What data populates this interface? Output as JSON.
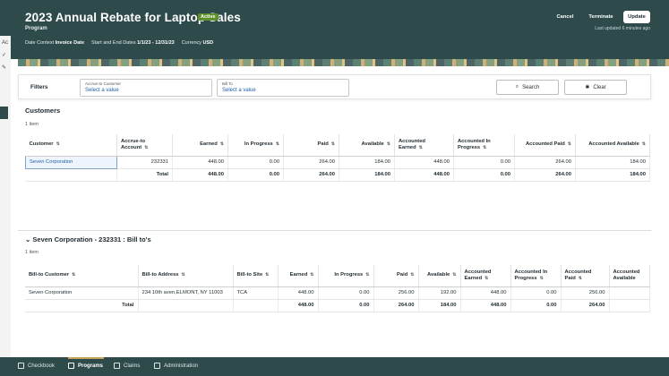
{
  "header": {
    "title": "2023 Annual Rebate for Laptop Sales",
    "badge": "Active",
    "subtitle": "Program",
    "meta": {
      "date_context_label": "Date Context",
      "date_context_value": "Invoice Date",
      "dates_label": "Start and End Dates",
      "dates_value": "1/1/23 - 12/31/23",
      "currency_label": "Currency",
      "currency_value": "USD"
    },
    "buttons": {
      "cancel": "Cancel",
      "terminate": "Terminate",
      "update": "Update"
    },
    "last_updated": "Last updated 6 minutes ago"
  },
  "filters": {
    "label": "Filters",
    "accrue_to_customer": {
      "label": "Accrue-to Customer",
      "placeholder": "Select a value"
    },
    "bill_to": {
      "label": "Bill To",
      "placeholder": "Select a value"
    },
    "search_label": "Search",
    "clear_label": "Clear"
  },
  "customers": {
    "title": "Customers",
    "count": "1 item",
    "columns": [
      "Customer",
      "Accrue-to Account",
      "Earned",
      "In Progress",
      "Paid",
      "Available",
      "Accounted Earned",
      "Accounted In Progress",
      "Accounted Paid",
      "Accounted Available"
    ],
    "rows": [
      [
        "Seven Corporation",
        "232331",
        "448.00",
        "0.00",
        "264.00",
        "184.00",
        "448.00",
        "0.00",
        "264.00",
        "184.00"
      ]
    ],
    "total": [
      "",
      "Total",
      "448.00",
      "0.00",
      "264.00",
      "184.00",
      "448.00",
      "0.00",
      "264.00",
      "184.00"
    ]
  },
  "billtos": {
    "title": "Seven Corporation - 232331 : Bill to's",
    "count": "1 item",
    "columns": [
      "Bill-to Customer",
      "Bill-to Address",
      "Bill-to Site",
      "Earned",
      "In Progress",
      "Paid",
      "Available",
      "Accounted Earned",
      "Accounted In Progress",
      "Accounted Paid",
      "Accounted Available"
    ],
    "rows": [
      [
        "Seven Corporation",
        "234 10th aven,ELMONT, NY 11003",
        "TCA",
        "448.00",
        "0.00",
        "256.00",
        "192.00",
        "448.00",
        "0.00",
        "256.00",
        ""
      ]
    ],
    "total": [
      "Total",
      "",
      "",
      "448.00",
      "0.00",
      "264.00",
      "184.00",
      "448.00",
      "0.00",
      "264.00",
      ""
    ]
  },
  "footer_nav": {
    "checkbook": "Checkbook",
    "programs": "Programs",
    "claims": "Claims",
    "administration": "Administration"
  },
  "colors": {
    "header": "#2e4a4b",
    "accent": "#c8a25a",
    "link": "#1f5fa8",
    "badge": "#5e8f2a"
  },
  "icons": [
    "search-icon",
    "clear-icon",
    "chevron-down-icon",
    "sort-icon",
    "checkbook-icon",
    "programs-icon",
    "claims-icon",
    "administration-icon"
  ]
}
